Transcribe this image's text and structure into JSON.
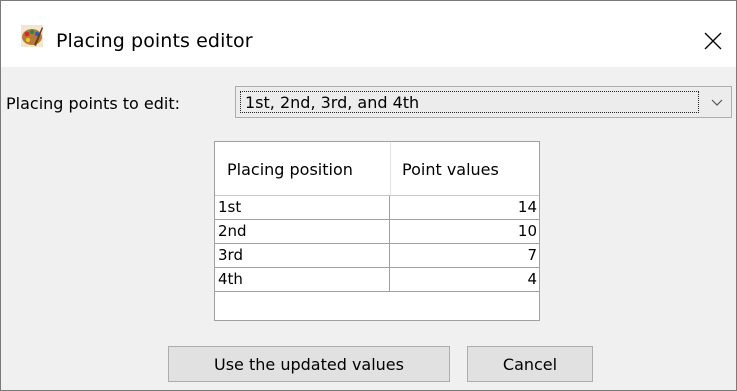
{
  "window": {
    "title": "Placing points editor",
    "icon": "paint-palette-icon",
    "close_icon": "close-icon"
  },
  "editor": {
    "label": "Placing points to edit:",
    "selected_option": "1st, 2nd, 3rd, and 4th"
  },
  "table": {
    "headers": [
      "Placing position",
      "Point values"
    ],
    "rows": [
      {
        "position": "1st",
        "points": "14"
      },
      {
        "position": "2nd",
        "points": "10"
      },
      {
        "position": "3rd",
        "points": "7"
      },
      {
        "position": "4th",
        "points": "4"
      }
    ]
  },
  "buttons": {
    "use_updated": "Use the updated values",
    "cancel": "Cancel"
  }
}
